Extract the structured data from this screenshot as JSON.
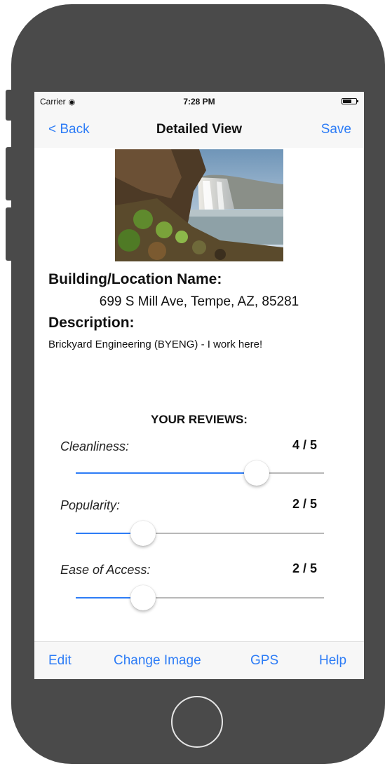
{
  "status_bar": {
    "carrier": "Carrier",
    "wifi_icon": "wifi-icon",
    "time": "7:28 PM",
    "battery_icon": "battery-icon"
  },
  "nav": {
    "back": "< Back",
    "title": "Detailed View",
    "save": "Save"
  },
  "detail": {
    "image_description_icon": "waterfall-photo",
    "name_label": "Building/Location Name:",
    "address": "699 S Mill Ave, Tempe, AZ, 85281",
    "description_label": "Description:",
    "description": "Brickyard Engineering (BYENG) - I work here!"
  },
  "reviews": {
    "title": "YOUR REVIEWS:",
    "items": [
      {
        "label": "Cleanliness:",
        "score_text": "4 / 5",
        "level": 0.73
      },
      {
        "label": "Popularity:",
        "score_text": "2 / 5",
        "level": 0.27
      },
      {
        "label": "Ease of Access:",
        "score_text": "2 / 5",
        "level": 0.27
      }
    ]
  },
  "toolbar": {
    "edit": "Edit",
    "change_image": "Change Image",
    "gps": "GPS",
    "help": "Help"
  },
  "colors": {
    "accent": "#2d7cf6",
    "phone_frame": "#4a4a4a",
    "bar_background": "#f7f7f7"
  }
}
